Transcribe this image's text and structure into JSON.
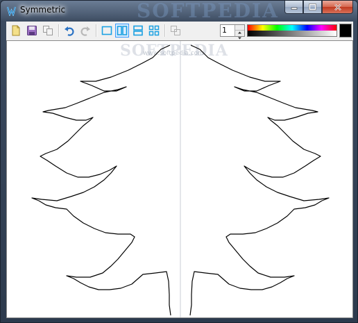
{
  "window": {
    "title": "Symmetric",
    "watermark": "SOFTPEDIA"
  },
  "toolbar": {
    "buttons": [
      {
        "name": "new",
        "icon": "new-document-icon"
      },
      {
        "name": "save",
        "icon": "save-disk-icon"
      },
      {
        "name": "copy",
        "icon": "copy-icon"
      },
      {
        "name": "undo",
        "icon": "undo-arrow-icon"
      },
      {
        "name": "redo",
        "icon": "redo-arrow-icon"
      },
      {
        "name": "symmetry-none",
        "icon": "single-panel-icon"
      },
      {
        "name": "symmetry-vertical",
        "icon": "vertical-split-icon",
        "active": true
      },
      {
        "name": "symmetry-horizontal",
        "icon": "horizontal-split-icon"
      },
      {
        "name": "symmetry-quad",
        "icon": "quad-split-icon"
      },
      {
        "name": "overlay",
        "icon": "overlay-icon"
      }
    ],
    "line_width": "1",
    "selected_color": "#000000"
  },
  "canvas": {
    "watermark": "SOFTPEDIA",
    "watermark_url": "www.softpedia.com",
    "axis_color": "#c8ccd4",
    "stroke_color": "#000000"
  }
}
